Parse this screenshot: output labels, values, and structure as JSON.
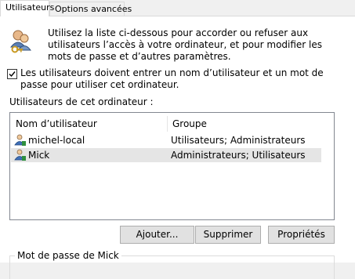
{
  "tabs": [
    {
      "label": "Utilisateurs",
      "active": true
    },
    {
      "label": "Options avancées",
      "active": false
    }
  ],
  "intro": {
    "icon": "users-keys-icon",
    "text": "Utilisez la liste ci-dessous pour accorder ou refuser aux utilisateurs l’accès à votre ordinateur, et pour modifier les mots de passe et d’autres paramètres."
  },
  "require_password": {
    "checked": true,
    "label": "Les utilisateurs doivent entrer un nom d’utilisateur et un mot de passe pour utiliser cet ordinateur."
  },
  "users_section_label": "Utilisateurs de cet ordinateur :",
  "users_table": {
    "columns": [
      "Nom d’utilisateur",
      "Groupe"
    ],
    "rows": [
      {
        "name": "michel-local",
        "group": "Utilisateurs; Administrateurs",
        "selected": false
      },
      {
        "name": "Mick",
        "group": "Administrateurs; Utilisateurs",
        "selected": true
      }
    ]
  },
  "buttons": {
    "add": "Ajouter...",
    "remove": "Supprimer",
    "properties": "Propriétés"
  },
  "password_group_label": "Mot de passe de Mick",
  "colors": {
    "selected_row": "#e5e5e5",
    "button_face": "#e1e1e1",
    "button_border": "#adadad"
  }
}
